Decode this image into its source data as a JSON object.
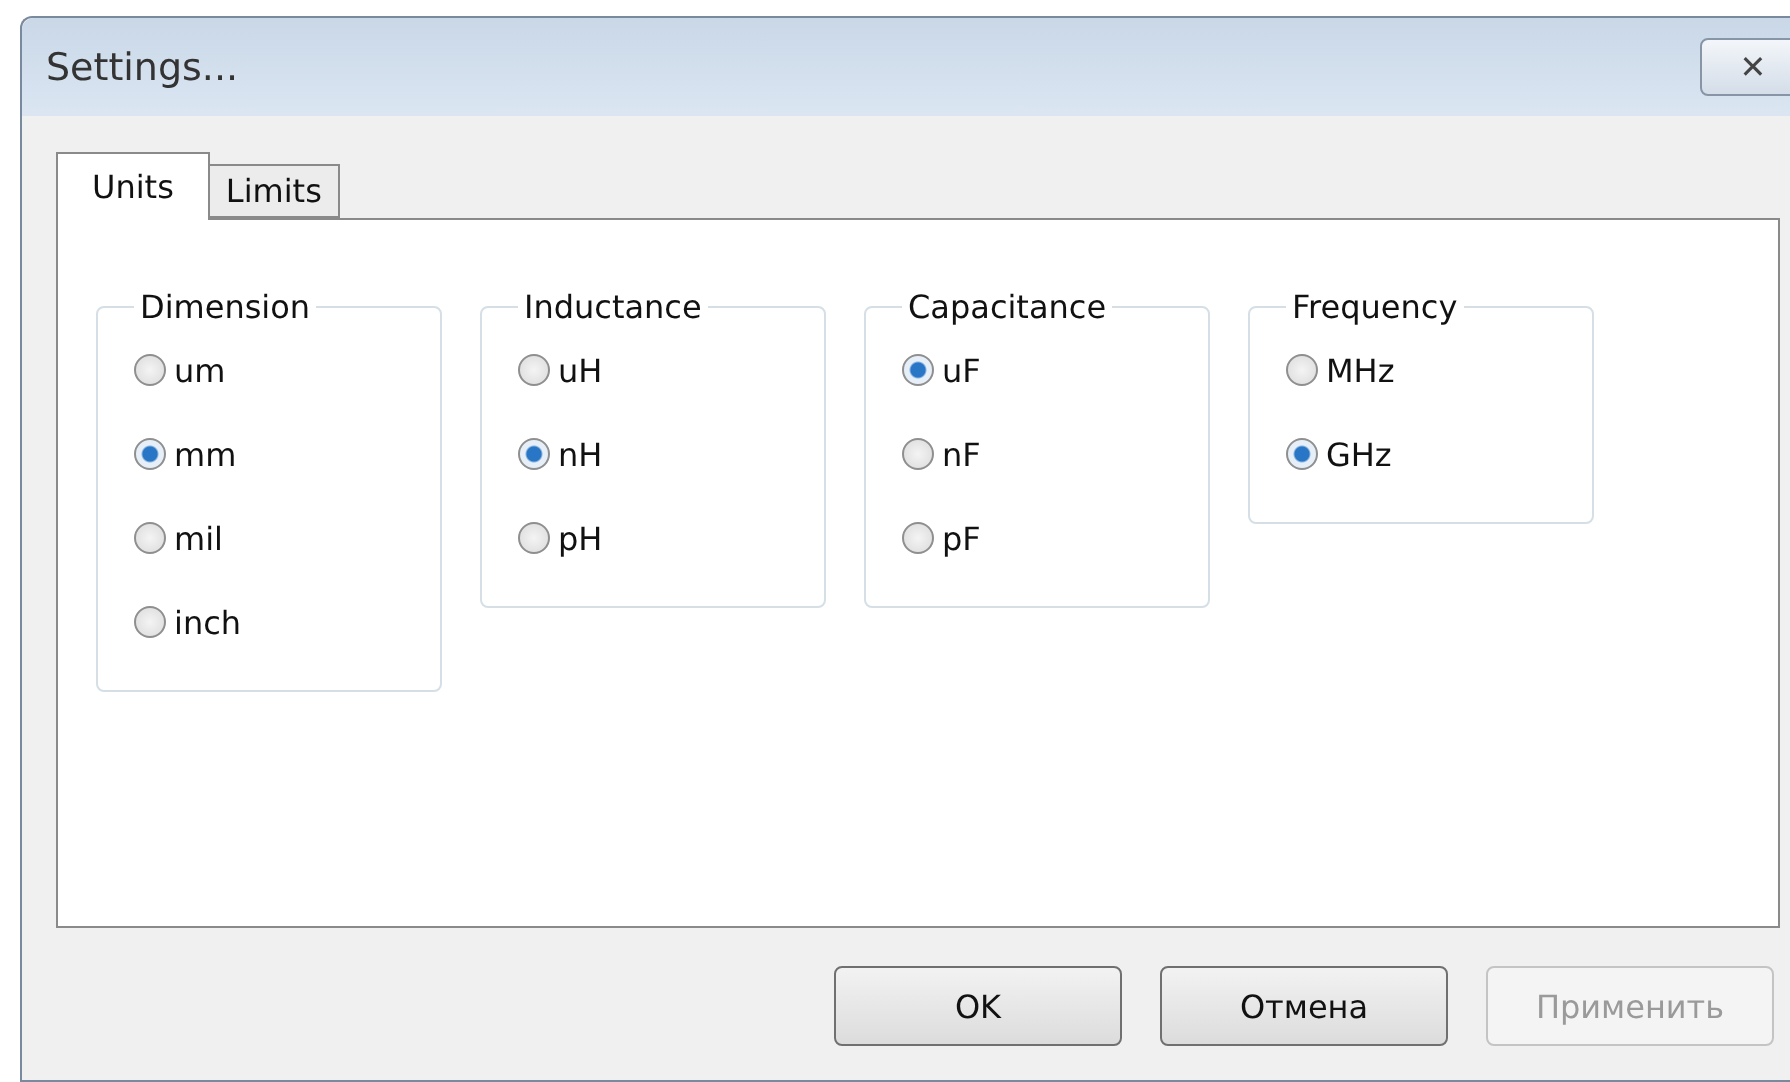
{
  "window": {
    "title": "Settings...",
    "close": "✕"
  },
  "tabs": [
    {
      "label": "Units",
      "selected": true
    },
    {
      "label": "Limits",
      "selected": false
    }
  ],
  "groups": [
    {
      "title": "Dimension",
      "options": [
        {
          "label": "um",
          "selected": false
        },
        {
          "label": "mm",
          "selected": true
        },
        {
          "label": "mil",
          "selected": false
        },
        {
          "label": "inch",
          "selected": false
        }
      ]
    },
    {
      "title": "Inductance",
      "options": [
        {
          "label": "uH",
          "selected": false
        },
        {
          "label": "nH",
          "selected": true
        },
        {
          "label": "pH",
          "selected": false
        }
      ]
    },
    {
      "title": "Capacitance",
      "options": [
        {
          "label": "uF",
          "selected": true
        },
        {
          "label": "nF",
          "selected": false
        },
        {
          "label": "pF",
          "selected": false
        }
      ]
    },
    {
      "title": "Frequency",
      "options": [
        {
          "label": "MHz",
          "selected": false
        },
        {
          "label": "GHz",
          "selected": true
        }
      ]
    }
  ],
  "buttons": [
    {
      "label": "OK",
      "disabled": false
    },
    {
      "label": "Отмена",
      "disabled": false
    },
    {
      "label": "Применить",
      "disabled": true
    }
  ]
}
